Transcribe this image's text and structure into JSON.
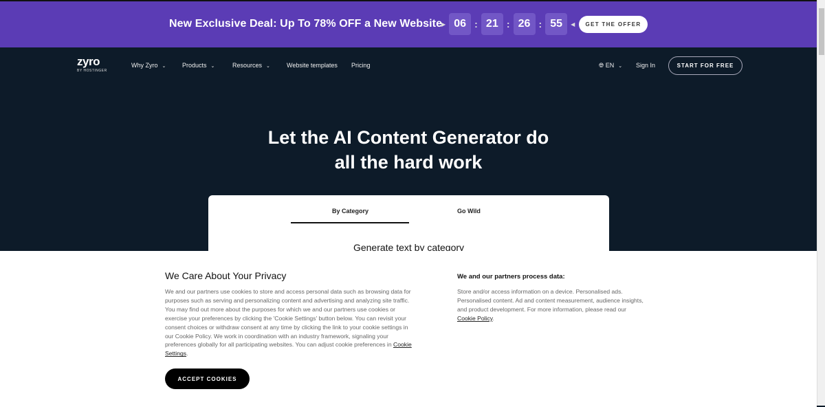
{
  "promo": {
    "text": "New Exclusive Deal: Up To 78% OFF a New Website",
    "timer": [
      "06",
      "21",
      "26",
      "55"
    ],
    "cta": "GET THE OFFER",
    "color": "#5b3cb5"
  },
  "nav": {
    "logo": "zyro",
    "logo_sub": "BY HOSTINGER",
    "items": [
      {
        "label": "Why Zyro"
      },
      {
        "label": "Products"
      },
      {
        "label": "Resources"
      },
      {
        "label": "Website templates"
      },
      {
        "label": "Pricing"
      }
    ],
    "lang": "EN",
    "sign_in": "Sign In",
    "start": "START FOR FREE"
  },
  "hero": {
    "line1": "Let the AI Content Generator do",
    "line2": "all the hard work"
  },
  "card": {
    "tabs": [
      "By Category",
      "Go Wild"
    ],
    "heading": "Generate text by category"
  },
  "cookie": {
    "title": "We Care About Your Privacy",
    "body": "We and our partners use cookies to store and access personal data such as browsing data for purposes such as serving and personalizing content and advertising and analyzing site traffic. You may find out more about the purposes for which we and our partners use cookies or exercise your preferences by clicking the 'Cookie Settings' button below. You can revisit your consent choices or withdraw consent at any time by clicking the link to your cookie settings in our Cookie Policy. We work in coordination with an industry framework, signaling your preferences globally for all participating websites. You can adjust cookie preferences in ",
    "settings_link": "Cookie Settings",
    "accept": "ACCEPT COOKIES",
    "right_title": "We and our partners process data:",
    "right_body": "Store and/or access information on a device. Personalised ads. Personalised content. Ad and content measurement, audience insights, and product development. For more information, please read our ",
    "policy_link": "Cookie Policy"
  }
}
